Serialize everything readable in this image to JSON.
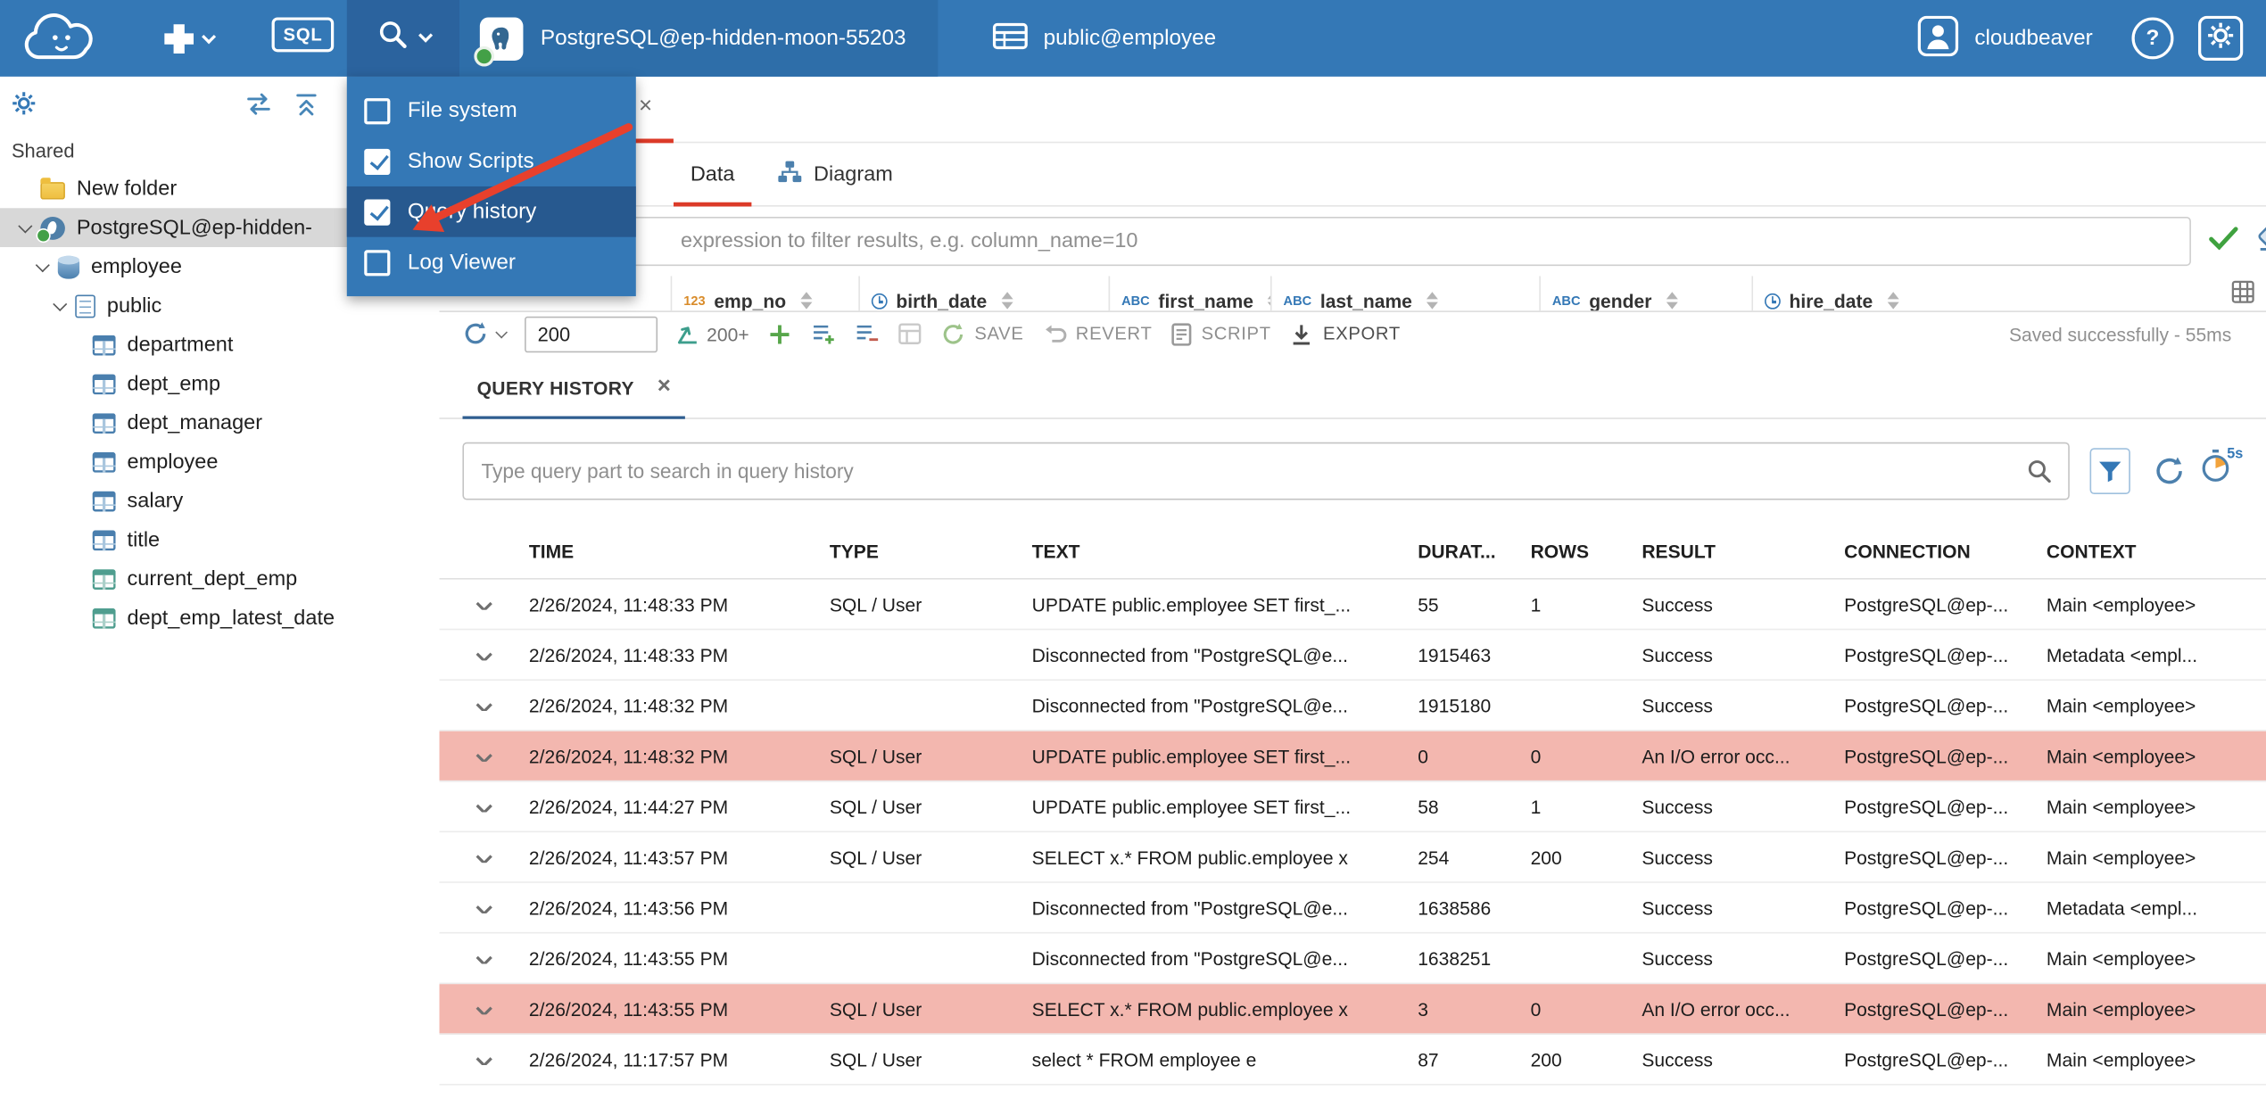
{
  "topbar": {
    "sql_label": "SQL",
    "connection_label": "PostgreSQL@ep-hidden-moon-55203",
    "schema_label": "public@employee",
    "user_label": "cloudbeaver",
    "help_label": "?"
  },
  "view_menu": {
    "items": [
      {
        "label": "File system",
        "state": "unchecked"
      },
      {
        "label": "Show Scripts",
        "state": "checked"
      },
      {
        "label": "Query history",
        "state": "checked",
        "classes": "hl"
      },
      {
        "label": "Log Viewer",
        "state": "unchecked"
      }
    ]
  },
  "sidebar": {
    "section_label": "Shared",
    "tree": [
      {
        "label": "New folder",
        "icon": "folder",
        "classes": "lvl-0"
      },
      {
        "label": "PostgreSQL@ep-hidden-",
        "icon": "postgres",
        "classes": "lvl-0 selected",
        "expandable": true
      },
      {
        "label": "employee",
        "icon": "database",
        "classes": "lvl-1",
        "expandable": true
      },
      {
        "label": "public",
        "icon": "schema",
        "classes": "lvl-2",
        "expandable": true
      },
      {
        "label": "department",
        "icon": "table",
        "classes": "lvl-3"
      },
      {
        "label": "dept_emp",
        "icon": "table",
        "classes": "lvl-3"
      },
      {
        "label": "dept_manager",
        "icon": "table",
        "classes": "lvl-3"
      },
      {
        "label": "employee",
        "icon": "table",
        "classes": "lvl-3"
      },
      {
        "label": "salary",
        "icon": "table",
        "classes": "lvl-3"
      },
      {
        "label": "title",
        "icon": "table",
        "classes": "lvl-3"
      },
      {
        "label": "current_dept_emp",
        "icon": "view",
        "classes": "lvl-3"
      },
      {
        "label": "dept_emp_latest_date",
        "icon": "view",
        "classes": "lvl-3"
      }
    ]
  },
  "object_page": {
    "tabs": [
      {
        "label": "Data"
      },
      {
        "label": "Diagram"
      }
    ],
    "filter_placeholder": "expression to filter results, e.g. column_name=10",
    "grid_columns": [
      {
        "type": "numeric",
        "label": "emp_no"
      },
      {
        "type": "date",
        "label": "birth_date"
      },
      {
        "type": "string",
        "label": "first_name"
      },
      {
        "type": "string",
        "label": "last_name"
      },
      {
        "type": "string",
        "label": "gender"
      },
      {
        "type": "date",
        "label": "hire_date"
      }
    ],
    "toolbar": {
      "row_limit": "200",
      "fetch_label": "200+",
      "save_label": "SAVE",
      "revert_label": "REVERT",
      "script_label": "SCRIPT",
      "export_label": "EXPORT",
      "status": "Saved successfully - 55ms"
    }
  },
  "query_history": {
    "tab_label": "QUERY HISTORY",
    "search_placeholder": "Type query part to search in query history",
    "refresh_interval": "5s",
    "columns": [
      "TIME",
      "TYPE",
      "TEXT",
      "DURAT...",
      "ROWS",
      "RESULT",
      "CONNECTION",
      "CONTEXT"
    ],
    "rows": [
      {
        "time": "2/26/2024, 11:48:33 PM",
        "type": "SQL / User",
        "text": "UPDATE public.employee SET first_...",
        "duration": "55",
        "rows": "1",
        "result": "Success",
        "connection": "PostgreSQL@ep-...",
        "context": "Main <employee>"
      },
      {
        "time": "2/26/2024, 11:48:33 PM",
        "type": "",
        "text": "Disconnected from \"PostgreSQL@e...",
        "duration": "1915463",
        "rows": "",
        "result": "Success",
        "connection": "PostgreSQL@ep-...",
        "context": "Metadata <empl..."
      },
      {
        "time": "2/26/2024, 11:48:32 PM",
        "type": "",
        "text": "Disconnected from \"PostgreSQL@e...",
        "duration": "1915180",
        "rows": "",
        "result": "Success",
        "connection": "PostgreSQL@ep-...",
        "context": "Main <employee>"
      },
      {
        "time": "2/26/2024, 11:48:32 PM",
        "type": "SQL / User",
        "text": "UPDATE public.employee SET first_...",
        "duration": "0",
        "rows": "0",
        "result": "An I/O error occ...",
        "connection": "PostgreSQL@ep-...",
        "context": "Main <employee>",
        "classes": "error"
      },
      {
        "time": "2/26/2024, 11:44:27 PM",
        "type": "SQL / User",
        "text": "UPDATE public.employee SET first_...",
        "duration": "58",
        "rows": "1",
        "result": "Success",
        "connection": "PostgreSQL@ep-...",
        "context": "Main <employee>"
      },
      {
        "time": "2/26/2024, 11:43:57 PM",
        "type": "SQL / User",
        "text": "SELECT x.* FROM public.employee x",
        "duration": "254",
        "rows": "200",
        "result": "Success",
        "connection": "PostgreSQL@ep-...",
        "context": "Main <employee>"
      },
      {
        "time": "2/26/2024, 11:43:56 PM",
        "type": "",
        "text": "Disconnected from \"PostgreSQL@e...",
        "duration": "1638586",
        "rows": "",
        "result": "Success",
        "connection": "PostgreSQL@ep-...",
        "context": "Metadata <empl..."
      },
      {
        "time": "2/26/2024, 11:43:55 PM",
        "type": "",
        "text": "Disconnected from \"PostgreSQL@e...",
        "duration": "1638251",
        "rows": "",
        "result": "Success",
        "connection": "PostgreSQL@ep-...",
        "context": "Main <employee>"
      },
      {
        "time": "2/26/2024, 11:43:55 PM",
        "type": "SQL / User",
        "text": "SELECT x.* FROM public.employee x",
        "duration": "3",
        "rows": "0",
        "result": "An I/O error occ...",
        "connection": "PostgreSQL@ep-...",
        "context": "Main <employee>",
        "classes": "error"
      },
      {
        "time": "2/26/2024, 11:17:57 PM",
        "type": "SQL / User",
        "text": "select * FROM employee e",
        "duration": "87",
        "rows": "200",
        "result": "Success",
        "connection": "PostgreSQL@ep-...",
        "context": "Main <employee>"
      }
    ]
  },
  "colors": {
    "topbar_blue": "#3478b6",
    "menu_highlight": "#27598f",
    "active_tab_red": "#dc3a28",
    "history_tab_underline": "#2f5e90",
    "error_row_pink": "#f3b7af",
    "status_green": "#43a047"
  }
}
